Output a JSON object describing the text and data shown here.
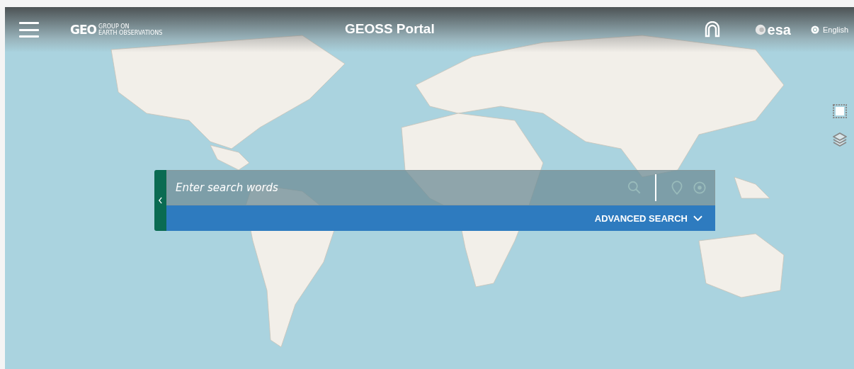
{
  "header": {
    "logo_text": "GEO",
    "logo_line_1": "GROUP ON",
    "logo_line_2": "EARTH OBSERVATIONS",
    "portal_title": "GEOSS Portal",
    "partner_logo": "esa",
    "language": "English"
  },
  "search": {
    "placeholder": "Enter search words",
    "advanced_search_label": "ADVANCED SEARCH"
  }
}
